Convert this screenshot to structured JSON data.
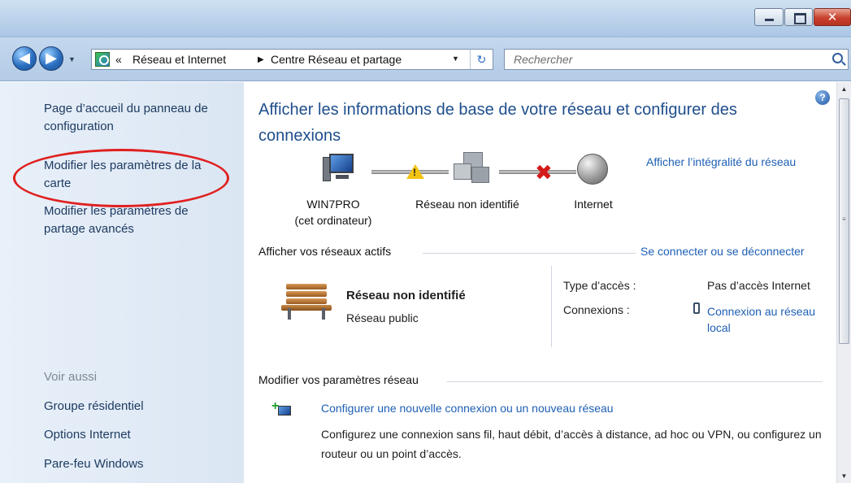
{
  "nav": {
    "back_glyph": "◀",
    "forward_glyph": "▶",
    "history_glyph": "▼",
    "breadcrumb_overflow": "«",
    "breadcrumb_sep": "▶",
    "breadcrumbs": [
      "Réseau et Internet",
      "Centre Réseau et partage"
    ],
    "dropdown_glyph": "▼",
    "refresh_glyph": "↻",
    "search_placeholder": "Rechercher"
  },
  "sidebar": {
    "links": [
      "Page d’accueil du panneau de configuration",
      "Modifier les paramètres de la carte",
      "Modifier les paramètres de partage avancés"
    ],
    "see_also_heading": "Voir aussi",
    "see_also": [
      "Groupe résidentiel",
      "Options Internet",
      "Pare-feu Windows"
    ]
  },
  "main": {
    "help_glyph": "?",
    "title": "Afficher les informations de base de votre réseau et configurer des connexions",
    "network_map": {
      "computer_label": "WIN7PRO\n(cet ordinateur)",
      "network_label": "Réseau non identifié",
      "internet_label": "Internet",
      "warning_glyph": "!",
      "error_glyph": "✖",
      "full_map_link": "Afficher l’intégralité du réseau"
    },
    "active_networks": {
      "heading": "Afficher vos réseaux actifs",
      "connect_link": "Se connecter ou se déconnecter",
      "name": "Réseau non identifié",
      "type": "Réseau public",
      "access_label": "Type d’accès :",
      "access_value": "Pas d’accès Internet",
      "connections_label": "Connexions :",
      "connections_value": "Connexion au réseau local"
    },
    "change_settings": {
      "heading": "Modifier vos paramètres réseau",
      "setup_link": "Configurer une nouvelle connexion ou un nouveau réseau",
      "setup_desc": "Configurez une connexion sans fil, haut débit, d’accès à distance, ad hoc ou VPN, ou configurez un routeur ou un point d’accès."
    }
  },
  "annotation": {
    "highlight_color": "#e02020"
  },
  "icons": [
    "back-icon",
    "forward-icon",
    "network-folder-icon",
    "refresh-icon",
    "search-icon",
    "help-icon",
    "computer-icon",
    "warning-icon",
    "network-icon",
    "error-icon",
    "globe-icon",
    "bench-icon",
    "plug-icon",
    "setup-connection-icon"
  ]
}
